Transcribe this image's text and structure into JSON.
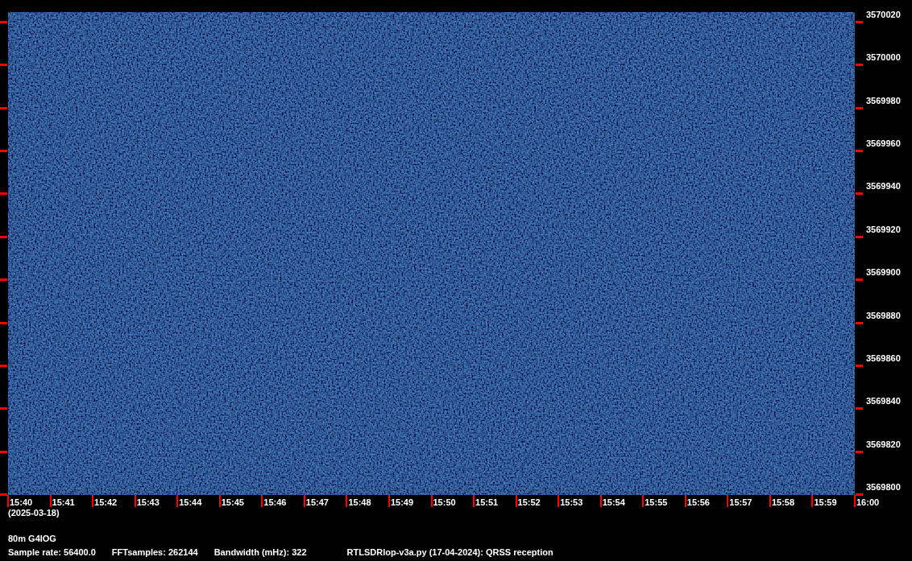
{
  "frequency_labels": [
    "3570020",
    "3570000",
    "3569980",
    "3569960",
    "3569940",
    "3569920",
    "3569900",
    "3569880",
    "3569860",
    "3569840",
    "3569820",
    "3569800"
  ],
  "time_labels": [
    "15:40",
    "15:41",
    "15:42",
    "15:43",
    "15:44",
    "15:45",
    "15:46",
    "15:47",
    "15:48",
    "15:49",
    "15:50",
    "15:51",
    "15:52",
    "15:53",
    "15:54",
    "15:55",
    "15:56",
    "15:57",
    "15:58",
    "15:59",
    "16:00"
  ],
  "date": "(2025-03-18)",
  "station": "80m G4IOG",
  "info": [
    "Sample rate: 56400.0",
    "FFTsamples: 262144",
    "Bandwidth (mHz): 322",
    "RTLSDRlop-v3a.py (17-04-2024): QRSS reception"
  ]
}
